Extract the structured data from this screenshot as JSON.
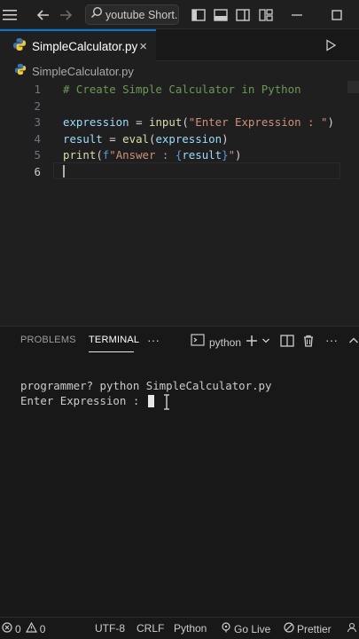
{
  "titlebar": {
    "search_text": "youtube Short...",
    "icons": [
      "menu-icon",
      "back-arrow-icon",
      "forward-arrow-icon",
      "search-icon",
      "toggle-primary-sidebar-icon",
      "toggle-panel-icon",
      "toggle-secondary-sidebar-icon",
      "customize-layout-icon",
      "minimize-icon",
      "maximize-icon"
    ]
  },
  "tab": {
    "label": "SimpleCalculator.py",
    "close": "×"
  },
  "breadcrumb": {
    "file": "SimpleCalculator.py"
  },
  "editor": {
    "lines": [
      {
        "num": "1",
        "text": "# Create Simple Calculator in Python"
      },
      {
        "num": "2",
        "text": ""
      },
      {
        "num": "3",
        "text": "expression = input(\"Enter Expression : \")"
      },
      {
        "num": "4",
        "text": "result = eval(expression)"
      },
      {
        "num": "5",
        "text": "print(f\"Answer : {result}\")"
      },
      {
        "num": "6",
        "text": ""
      }
    ],
    "tokens": {
      "l1": "# Create Simple Calculator in Python",
      "l3_var": "expression",
      "l3_eq": " = ",
      "l3_fn": "input",
      "l3_open": "(",
      "l3_str": "\"Enter Expression : \"",
      "l3_close": ")",
      "l4_var": "result",
      "l4_eq": " = ",
      "l4_fn": "eval",
      "l4_open": "(",
      "l4_arg": "expression",
      "l4_close": ")",
      "l5_fn": "print",
      "l5_open": "(",
      "l5_f": "f",
      "l5_str1": "\"Answer : ",
      "l5_lb": "{",
      "l5_var": "result",
      "l5_rb": "}",
      "l5_str2": "\"",
      "l5_close": ")"
    }
  },
  "panel": {
    "tabs": [
      "PROBLEMS",
      "TERMINAL"
    ],
    "active_tab": "TERMINAL",
    "more": "···",
    "terminal_profile": "python",
    "terminal_lines": [
      "programmer? python SimpleCalculator.py",
      "Enter Expression : "
    ]
  },
  "statusbar": {
    "errors": "0",
    "warnings": "0",
    "encoding": "UTF-8",
    "eol": "CRLF",
    "language": "Python",
    "go_live": "Go Live",
    "prettier": "Prettier"
  },
  "colors": {
    "accent": "#0078d4",
    "editor_bg": "#1f1f1f",
    "panel_bg": "#181818",
    "comment": "#6a9955",
    "string": "#ce9178",
    "function": "#dcdcaa",
    "variable": "#9cdcfe"
  }
}
